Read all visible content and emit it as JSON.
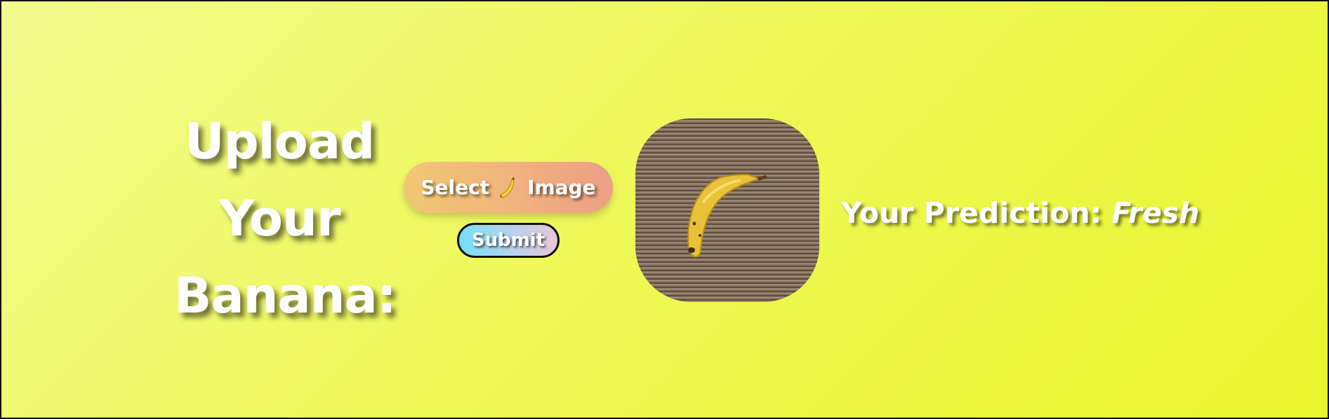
{
  "heading": {
    "line1": "Upload",
    "line2": "Your",
    "line3": "Banana:"
  },
  "upload": {
    "select_label_before": "Select",
    "select_icon": "banana-emoji-icon",
    "select_label_after": "Image",
    "submit_label": "Submit"
  },
  "preview": {
    "image": "banana-on-cardboard-photo"
  },
  "prediction": {
    "label": "Your Prediction:",
    "value": "Fresh"
  },
  "colors": {
    "background_start": "#f3fb8e",
    "background_end": "#e9f52c",
    "select_button_start": "#f0c872",
    "select_button_end": "#ee9e86",
    "submit_button_start": "#74dff7",
    "submit_button_end": "#e9c7d8",
    "text": "#ffffff"
  }
}
